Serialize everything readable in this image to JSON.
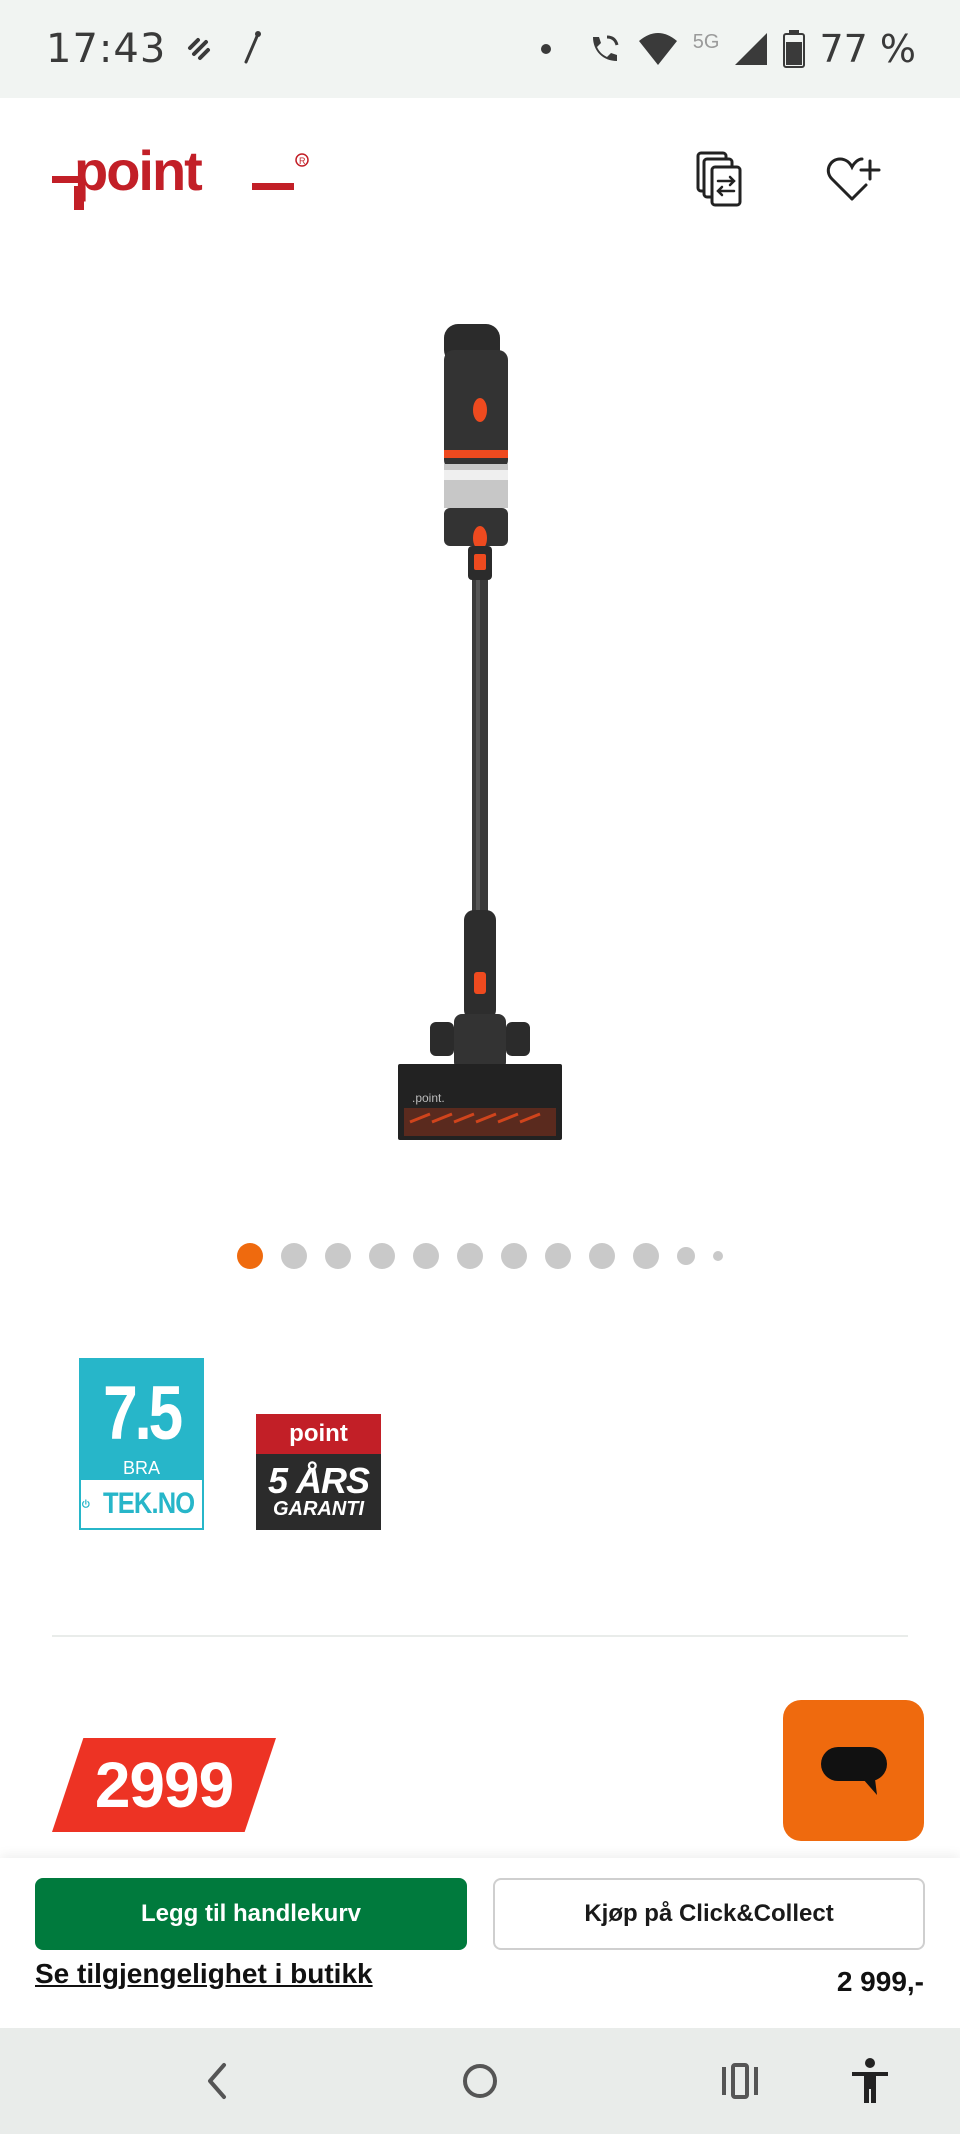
{
  "status_bar": {
    "time": "17:43",
    "battery": "77 %",
    "network": "5G"
  },
  "header": {
    "logo_text": "point",
    "logo_color": "#c21f27"
  },
  "carousel": {
    "total_dots": 12,
    "active_index": 0
  },
  "badges": {
    "tek": {
      "score": "7.5",
      "label": "BRA",
      "brand": "TEK.NO"
    },
    "garanti": {
      "logo": "point",
      "years": "5 ÅRS",
      "word": "GARANTI"
    }
  },
  "price": {
    "tag": "2999",
    "formatted": "2 999,-"
  },
  "actions": {
    "add_to_cart": "Legg til handlekurv",
    "click_collect": "Kjøp på Click&Collect",
    "availability": "Se tilgjengelighet i butikk"
  },
  "colors": {
    "accent_orange": "#ef6a0e",
    "brand_red": "#c21f27",
    "price_red": "#ed3324",
    "cart_green": "#007a3d",
    "tek_blue": "#27b6c9"
  },
  "icons": {
    "compare": "compare-icon",
    "wishlist": "heart-plus-icon",
    "chat": "chat-icon",
    "back": "back-icon",
    "home": "home-icon",
    "recents": "recents-icon",
    "accessibility": "accessibility-icon"
  }
}
